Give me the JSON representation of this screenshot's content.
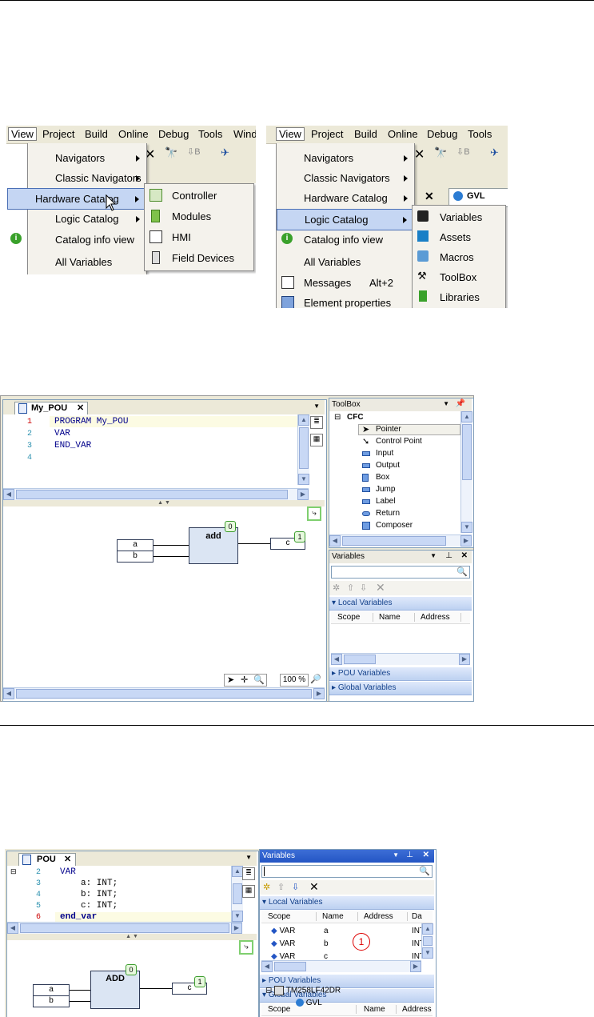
{
  "menu_left": {
    "menubar": [
      "View",
      "Project",
      "Build",
      "Online",
      "Debug",
      "Tools",
      "Wind"
    ],
    "items": [
      {
        "label": "Navigators",
        "arrow": true
      },
      {
        "label": "Classic Navigators",
        "arrow": true
      },
      {
        "label": "Hardware Catalog",
        "arrow": true,
        "highlight": true
      },
      {
        "label": "Logic Catalog",
        "arrow": true
      },
      {
        "label": "Catalog info view",
        "arrow": false
      },
      {
        "label": "All Variables",
        "arrow": false
      }
    ],
    "submenu": [
      "Controller",
      "Modules",
      "HMI",
      "Field Devices"
    ]
  },
  "menu_right": {
    "menubar": [
      "View",
      "Project",
      "Build",
      "Online",
      "Debug",
      "Tools"
    ],
    "items": [
      {
        "label": "Navigators",
        "arrow": true
      },
      {
        "label": "Classic Navigators",
        "arrow": true
      },
      {
        "label": "Hardware Catalog",
        "arrow": true
      },
      {
        "label": "Logic Catalog",
        "arrow": true,
        "highlight": true
      },
      {
        "label": "Catalog info view",
        "arrow": false
      },
      {
        "label": "All Variables",
        "arrow": false
      },
      {
        "label": "Messages",
        "shortcut": "Alt+2"
      },
      {
        "label": "Element properties"
      }
    ],
    "submenu": [
      "Variables",
      "Assets",
      "Macros",
      "ToolBox",
      "Libraries"
    ],
    "bg_tab": "GVL"
  },
  "ide1": {
    "tab": "My_POU",
    "lines": [
      {
        "n": "1",
        "text": "PROGRAM My_POU"
      },
      {
        "n": "2",
        "text": "VAR"
      },
      {
        "n": "3",
        "text": "END_VAR"
      },
      {
        "n": "4",
        "text": ""
      }
    ],
    "block": {
      "name": "add",
      "badge": "0",
      "inputs": [
        "a",
        "b"
      ],
      "output": "c",
      "out_badge": "1"
    },
    "zoom": "100 %",
    "toolbox": {
      "title": "ToolBox",
      "group": "CFC",
      "items": [
        "Pointer",
        "Control Point",
        "Input",
        "Output",
        "Box",
        "Jump",
        "Label",
        "Return",
        "Composer"
      ]
    },
    "variables": {
      "title": "Variables",
      "local": "Local Variables",
      "cols": [
        "Scope",
        "Name",
        "Address"
      ],
      "pou": "POU Variables",
      "global": "Global Variables"
    }
  },
  "ide2": {
    "tab": "POU",
    "lines": [
      {
        "n": "2",
        "text": "VAR"
      },
      {
        "n": "3",
        "text": "a: INT;"
      },
      {
        "n": "4",
        "text": "b: INT;"
      },
      {
        "n": "5",
        "text": "c: INT;"
      },
      {
        "n": "6",
        "text": "end_var"
      }
    ],
    "block": {
      "name": "ADD",
      "badge": "0",
      "inputs": [
        "a",
        "b"
      ],
      "output": "c",
      "out_badge": "1"
    },
    "variables": {
      "title": "Variables",
      "local": "Local Variables",
      "cols": [
        "Scope",
        "Name",
        "Address",
        "Da"
      ],
      "rows": [
        {
          "scope": "VAR",
          "name": "a",
          "type": "INT"
        },
        {
          "scope": "VAR",
          "name": "b",
          "type": "INT"
        },
        {
          "scope": "VAR",
          "name": "c",
          "type": "INT"
        }
      ],
      "callout": "1",
      "pou": "POU Variables",
      "global": "Global Variables",
      "global_cols": [
        "Scope",
        "Name",
        "Address"
      ],
      "tree": [
        "TM258LF42DR",
        "GVL"
      ]
    }
  }
}
